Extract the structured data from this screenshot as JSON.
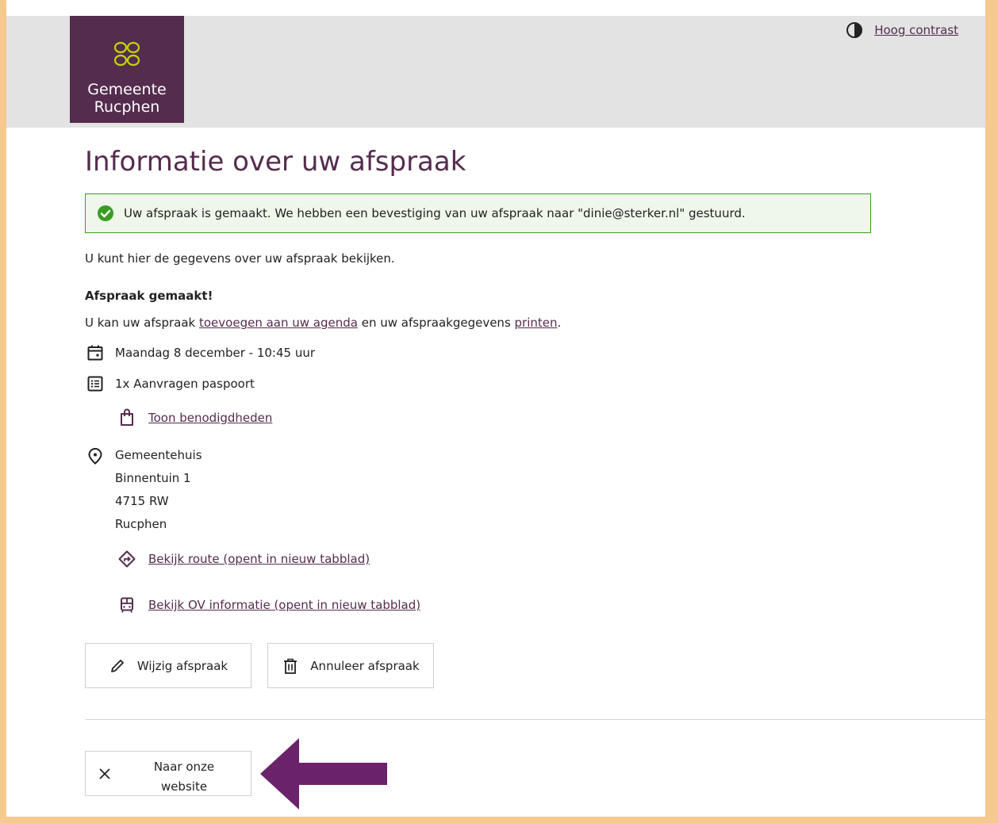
{
  "header": {
    "logo_line1": "Gemeente",
    "logo_line2": "Rucphen",
    "contrast_label": "Hoog contrast"
  },
  "page_title": "Informatie over uw afspraak",
  "alert": {
    "message": "Uw afspraak is gemaakt. We hebben een bevestiging van uw afspraak naar \"dinie@sterker.nl\" gestuurd."
  },
  "intro": "U kunt hier de gegevens over uw afspraak bekijken.",
  "section_heading": "Afspraak gemaakt!",
  "agenda_line": {
    "prefix": "U kan uw afspraak ",
    "agenda_link": "toevoegen aan uw agenda",
    "middle": " en uw afspraakgegevens ",
    "print_link": "printen",
    "suffix": "."
  },
  "appointment": {
    "datetime": "Maandag 8 december - 10:45 uur",
    "product": "1x Aanvragen paspoort",
    "requirements_link": "Toon benodigdheden",
    "location": {
      "name": "Gemeentehuis",
      "street": "Binnentuin 1",
      "postcode": "4715 RW",
      "city": "Rucphen"
    },
    "route_link": "Bekijk route (opent in nieuw tabblad)",
    "ov_link": "Bekijk OV informatie (opent in nieuw tabblad)"
  },
  "buttons": {
    "edit": "Wijzig afspraak",
    "cancel": "Annuleer afspraak",
    "website_line1": "Naar onze",
    "website_line2": "website"
  },
  "icons": {
    "logo": "flower-logo-icon",
    "contrast": "half-circle-contrast-icon",
    "success": "check-circle-icon",
    "calendar": "calendar-icon",
    "list": "list-icon",
    "bag": "shopping-bag-icon",
    "location": "map-pin-icon",
    "route": "route-diamond-icon",
    "ov": "bus-icon",
    "edit": "pencil-icon",
    "cancel": "trash-icon",
    "close": "close-icon",
    "annotation": "arrow-left-annotation"
  },
  "colors": {
    "brand": "#542c4e",
    "logo_accent": "#c3d500",
    "success": "#3a9d23",
    "header_bg": "#e3e3e3",
    "border_frame": "#f5c98f",
    "annotation_arrow": "#6a226a"
  }
}
